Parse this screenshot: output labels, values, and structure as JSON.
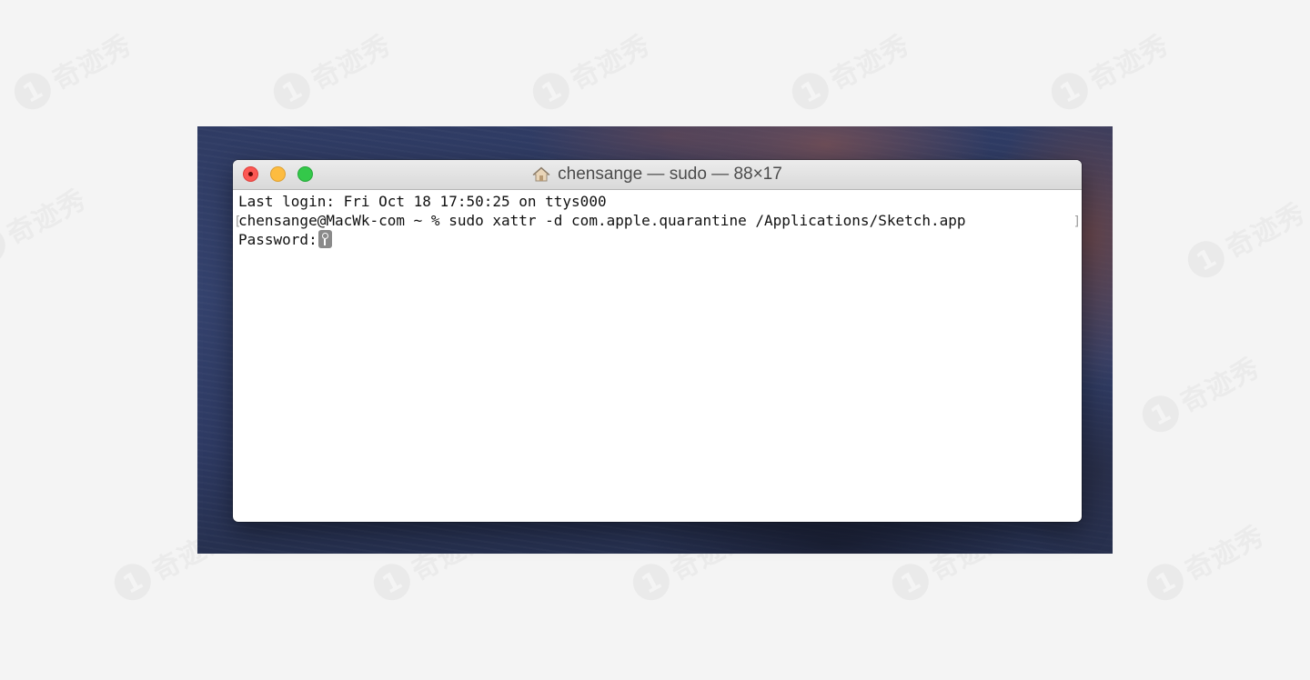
{
  "watermark": {
    "logo": "1",
    "text": "奇迹秀"
  },
  "window": {
    "title": "chensange — sudo — 88×17",
    "title_icon": "home-icon"
  },
  "terminal": {
    "lines": [
      "Last login: Fri Oct 18 17:50:25 on ttys000",
      "chensange@MacWk-com ~ % sudo xattr -d com.apple.quarantine /Applications/Sketch.app",
      "Password:"
    ],
    "password_indicator_icon": "key-icon"
  },
  "colors": {
    "close": "#fc5753",
    "minimize": "#fdbc40",
    "maximize": "#34c84a"
  }
}
